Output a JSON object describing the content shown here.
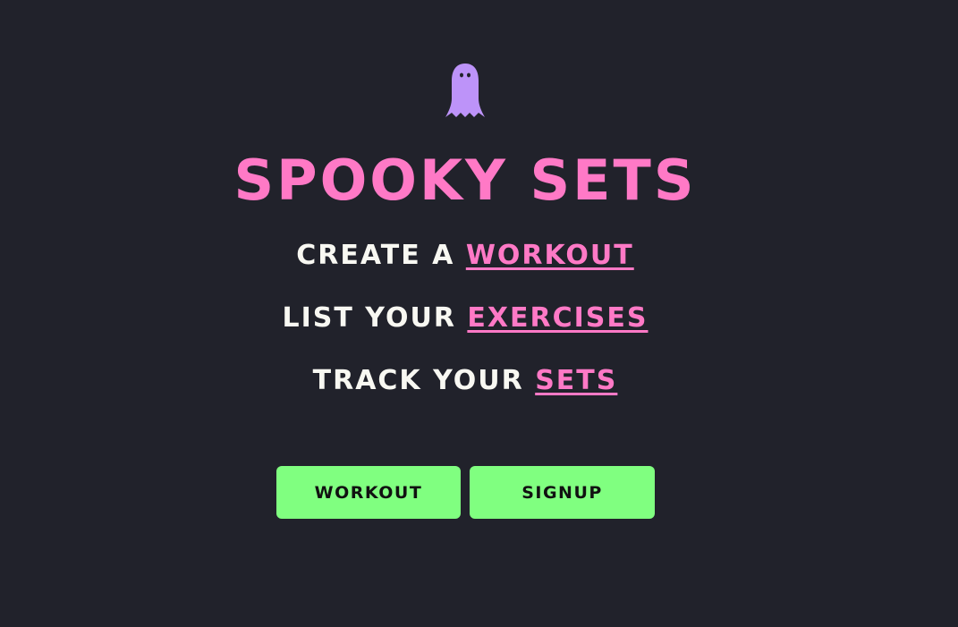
{
  "colors": {
    "background": "#21222b",
    "title": "#ff79c6",
    "link": "#ff79c6",
    "text": "#f8f8f2",
    "button": "#80ff80",
    "ghost": "#bd93f9"
  },
  "logo": {
    "icon": "ghost-icon"
  },
  "title": "Spooky Sets",
  "taglines": [
    {
      "prefix": "Create a ",
      "link": "Workout"
    },
    {
      "prefix": "List your ",
      "link": "Exercises"
    },
    {
      "prefix": "Track your ",
      "link": "Sets"
    }
  ],
  "buttons": {
    "workout": "Workout",
    "signup": "Signup"
  }
}
